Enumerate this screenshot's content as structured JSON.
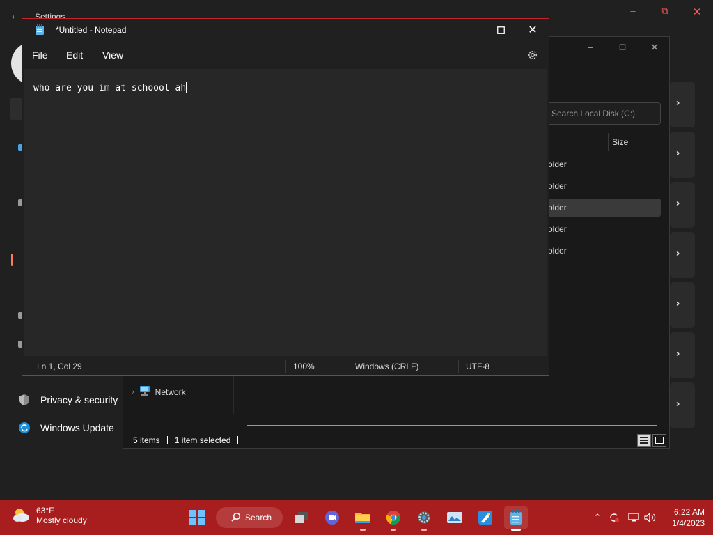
{
  "settings": {
    "title": "Settings",
    "nav": [
      {
        "label": "Privacy & security",
        "icon": "shield-icon"
      },
      {
        "label": "Windows Update",
        "icon": "update-icon"
      }
    ],
    "cards": 7
  },
  "explorer": {
    "search_placeholder": "Search Local Disk (C:)",
    "column_size": "Size",
    "rows": [
      {
        "type": "older",
        "selected": false
      },
      {
        "type": "older",
        "selected": false
      },
      {
        "type": "older",
        "selected": true
      },
      {
        "type": "older",
        "selected": false
      },
      {
        "type": "older",
        "selected": false
      }
    ],
    "nav_network": "Network",
    "status_items": "5 items",
    "status_selected": "1 item selected"
  },
  "notepad": {
    "title": "*Untitled - Notepad",
    "menu": [
      "File",
      "Edit",
      "View"
    ],
    "content": "who are you im at schoool ah",
    "status": {
      "position": "Ln 1, Col 29",
      "zoom": "100%",
      "line_ending": "Windows (CRLF)",
      "encoding": "UTF-8"
    }
  },
  "taskbar": {
    "weather_temp": "63°F",
    "weather_condition": "Mostly cloudy",
    "search_label": "Search",
    "time": "6:22 AM",
    "date": "1/4/2023",
    "accent_color": "#a81d1d"
  }
}
